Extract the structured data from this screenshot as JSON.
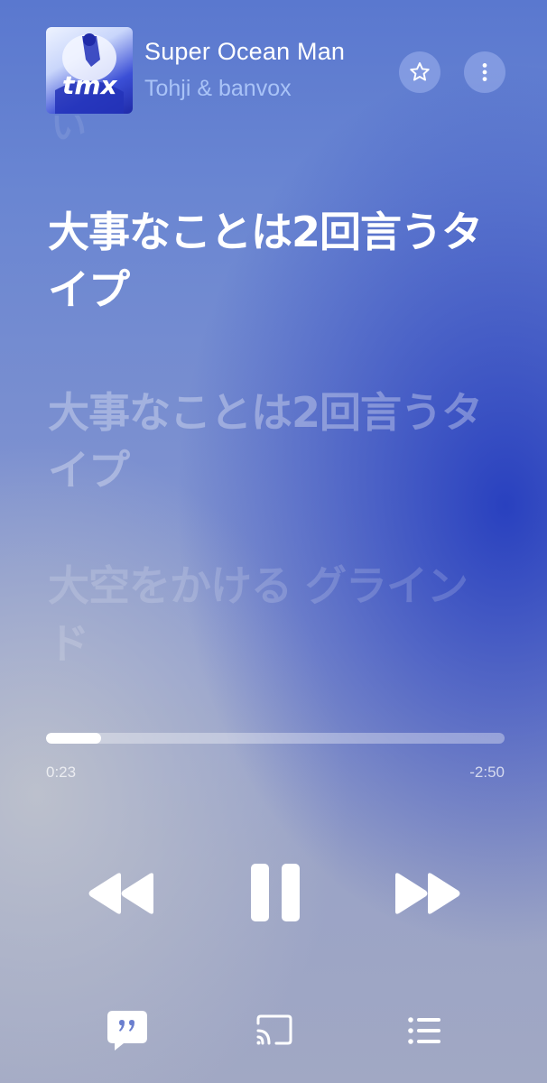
{
  "track": {
    "title": "Super Ocean Man",
    "artist": "Tohji & banvox",
    "album_art_text": "tmx"
  },
  "header_buttons": {
    "favorite_icon": "star-icon",
    "more_icon": "more-vertical-icon"
  },
  "lyrics": {
    "current": "大事なことは2回言うタイプ",
    "next": "大事なことは2回言うタイプ",
    "later": "大空をかける グラインド"
  },
  "playback": {
    "elapsed": "0:23",
    "remaining": "-2:50",
    "progress_fraction": 0.12
  },
  "controls": {
    "rewind_icon": "rewind-icon",
    "pause_icon": "pause-icon",
    "forward_icon": "fast-forward-icon"
  },
  "bottom_bar": {
    "lyrics_icon": "lyrics-quote-icon",
    "cast_icon": "cast-icon",
    "queue_icon": "queue-list-icon"
  },
  "colors": {
    "accent_background": "#3a55c8",
    "artist_text": "#a9c3f7",
    "primary_text": "#ffffff"
  }
}
